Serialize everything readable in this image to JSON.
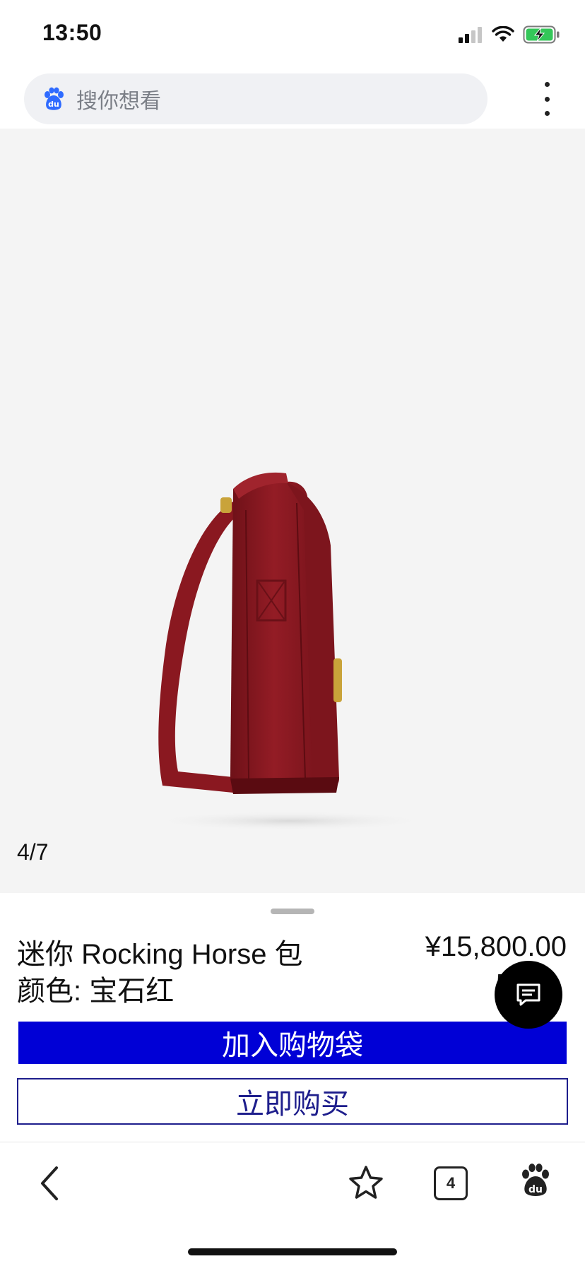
{
  "status_bar": {
    "time": "13:50",
    "icons": [
      "signal-icon",
      "wifi-icon",
      "battery-charging-icon"
    ]
  },
  "search": {
    "placeholder": "搜你想看",
    "logo": "baidu-paw-icon"
  },
  "gallery": {
    "counter": "4/7"
  },
  "product": {
    "name": "迷你 Rocking Horse 包",
    "color_line": "颜色: 宝石红",
    "price": "¥15,800.00",
    "price_secondary_partial": "5"
  },
  "actions": {
    "add_to_bag": "加入购物袋",
    "buy_now": "立即购买"
  },
  "toolbar": {
    "tab_count": "4",
    "icons": [
      "back-icon",
      "star-icon",
      "tabs-icon",
      "baidu-home-icon"
    ]
  },
  "colors": {
    "primary_blue": "#0000d6",
    "outline_blue": "#1e1e8c",
    "image_bg": "#f4f4f4",
    "bag_red": "#8e1a22"
  }
}
